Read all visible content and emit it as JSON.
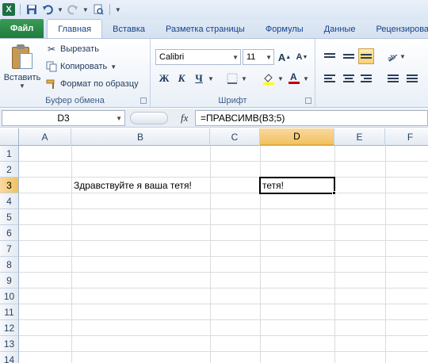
{
  "quick_access": {
    "app_logo": "X",
    "save_icon": "save-icon",
    "undo_icon": "undo-icon",
    "redo_icon": "redo-icon",
    "print_preview_icon": "print-preview-icon"
  },
  "tabs": [
    {
      "label": "Файл"
    },
    {
      "label": "Главная"
    },
    {
      "label": "Вставка"
    },
    {
      "label": "Разметка страницы"
    },
    {
      "label": "Формулы"
    },
    {
      "label": "Данные"
    },
    {
      "label": "Рецензирование"
    }
  ],
  "ribbon": {
    "clipboard": {
      "paste_label": "Вставить",
      "cut_label": "Вырезать",
      "copy_label": "Копировать",
      "format_painter_label": "Формат по образцу",
      "group_label": "Буфер обмена"
    },
    "font": {
      "font_name": "Calibri",
      "font_size": "11",
      "bold_label": "Ж",
      "italic_label": "К",
      "underline_label": "Ч",
      "group_label": "Шрифт"
    },
    "colors": {
      "fill_color": "#ffff00",
      "font_color": "#c00000"
    }
  },
  "formula_bar": {
    "name_box": "D3",
    "fx_label": "fx",
    "formula": "=ПРАВСИМВ(B3;5)"
  },
  "sheet": {
    "columns": [
      "A",
      "B",
      "C",
      "D",
      "E",
      "F"
    ],
    "rows": [
      "1",
      "2",
      "3",
      "4",
      "5",
      "6",
      "7",
      "8",
      "9",
      "10",
      "11",
      "12",
      "13",
      "14"
    ],
    "active_column": "D",
    "active_row": "3",
    "cells": {
      "B3": "Здравствуйте я ваша тетя!",
      "D3": "тетя!"
    }
  }
}
